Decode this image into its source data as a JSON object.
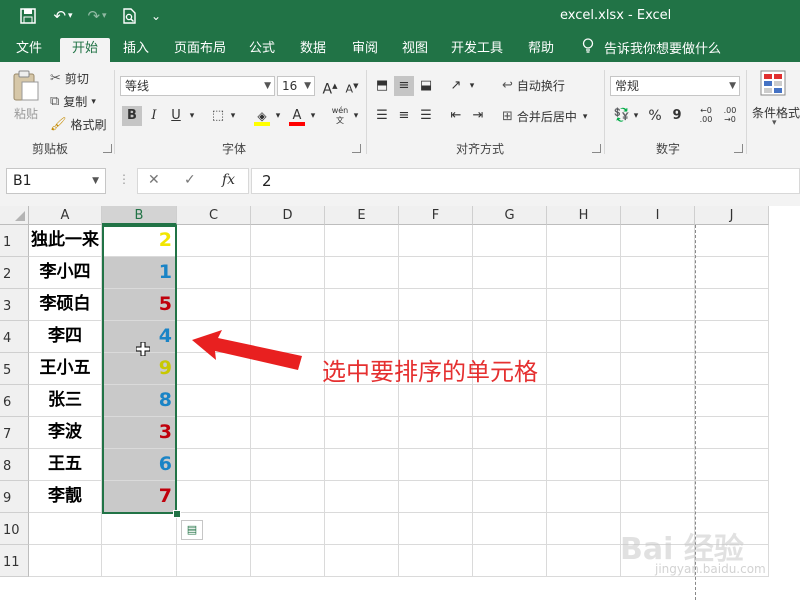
{
  "title_bar": {
    "title": "excel.xlsx  -  Excel"
  },
  "tabs": [
    "文件",
    "开始",
    "插入",
    "页面布局",
    "公式",
    "数据",
    "审阅",
    "视图",
    "开发工具",
    "帮助"
  ],
  "active_tab": "开始",
  "tell_me": "告诉我你想要做什么",
  "ribbon": {
    "clipboard": {
      "paste": "粘贴",
      "cut": "剪切",
      "copy": "复制",
      "format_painter": "格式刷",
      "label": "剪贴板"
    },
    "font": {
      "name": "等线",
      "size": "16",
      "label": "字体",
      "bold": "B",
      "italic": "I",
      "underline": "U",
      "grow": "A",
      "shrink": "A",
      "fill_color": "#ffff00",
      "font_color": "#ff0000",
      "phonetic": "wén"
    },
    "alignment": {
      "wrap_text": "自动换行",
      "merge_center": "合并后居中",
      "label": "对齐方式"
    },
    "number": {
      "format": "常规",
      "percent": "%",
      "comma": "9",
      "label": "数字"
    },
    "styles": {
      "conditional": "条件格式"
    }
  },
  "formula_bar": {
    "name_box": "B1",
    "cancel": "✕",
    "confirm": "✓",
    "fx": "fx",
    "value": "2"
  },
  "grid": {
    "columns": [
      "A",
      "B",
      "C",
      "D",
      "E",
      "F",
      "G",
      "H",
      "I",
      "J"
    ],
    "rows": [
      "1",
      "2",
      "3",
      "4",
      "5",
      "6",
      "7",
      "8",
      "9",
      "10",
      "11"
    ],
    "names": [
      "独此一来",
      "李小四",
      "李硕白",
      "李四",
      "王小五",
      "张三",
      "李波",
      "王五",
      "李靓"
    ],
    "numbers": [
      {
        "v": "2",
        "color": "#f2e600"
      },
      {
        "v": "1",
        "color": "#1a84c6"
      },
      {
        "v": "5",
        "color": "#c0000c"
      },
      {
        "v": "4",
        "color": "#1a84c6"
      },
      {
        "v": "9",
        "color": "#c8c800"
      },
      {
        "v": "8",
        "color": "#1a84c6"
      },
      {
        "v": "3",
        "color": "#c0000c"
      },
      {
        "v": "6",
        "color": "#1a84c6"
      },
      {
        "v": "7",
        "color": "#c0000c"
      }
    ]
  },
  "annotation": "选中要排序的单元格",
  "watermark": {
    "text": "Bai 经验",
    "url": "jingyan.baidu.com"
  }
}
